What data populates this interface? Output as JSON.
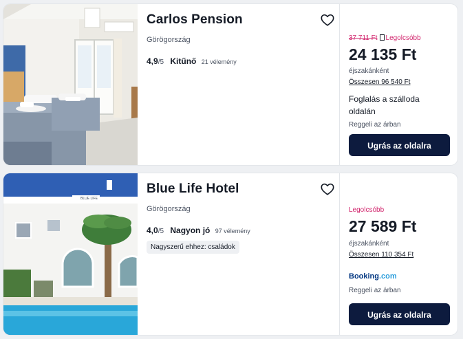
{
  "hotels": [
    {
      "name": "Carlos Pension",
      "country": "Görögország",
      "score": "4,9",
      "score_out_of": "/5",
      "rating_word": "Kitűnő",
      "reviews": "21 vélemény",
      "old_price": "37 711 Ft",
      "best_label": "Legolcsóbb",
      "price": "24 135 Ft",
      "per_night": "éjszakánként",
      "total": "Összesen 96 540 Ft",
      "booking_note": "Foglalás a szálloda oldalán",
      "tax_note": "Reggeli az árban",
      "cta": "Ugrás az oldalra",
      "heart_icon": "heart-outline-icon"
    },
    {
      "name": "Blue Life Hotel",
      "country": "Görögország",
      "score": "4,0",
      "score_out_of": "/5",
      "rating_word": "Nagyon jó",
      "reviews": "97 vélemény",
      "tag": "Nagyszerű ehhez: családok",
      "best_label": "Legolcsóbb",
      "price": "27 589 Ft",
      "per_night": "éjszakánként",
      "total": "Összesen 110 354 Ft",
      "provider_name": "Booking",
      "provider_suffix": ".com",
      "tax_note": "Reggeli az árban",
      "cta": "Ugrás az oldalra",
      "heart_icon": "heart-outline-icon",
      "sign_text": "BLUE LIFE"
    }
  ],
  "colors": {
    "deal": "#d1246c",
    "cta_bg": "#0d1b3e",
    "booking_blue": "#003580",
    "booking_light": "#2a9ddb"
  }
}
